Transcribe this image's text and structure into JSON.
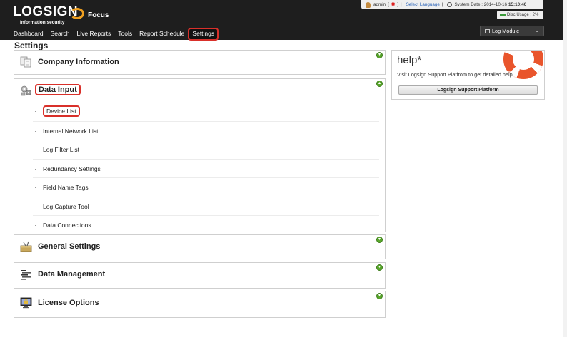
{
  "header": {
    "logo_text": "LOGSIGN",
    "logo_tagline": "information security",
    "product": "Focus",
    "nav": [
      "Dashboard",
      "Search",
      "Live Reports",
      "Tools",
      "Report Schedule",
      "Settings"
    ],
    "active_nav": "Settings",
    "status": {
      "user": "admin",
      "bracket_open": "[",
      "bracket_close": "]",
      "separator": "|",
      "language_link": "Select Language",
      "date_label": "System Date : 2014-10-16",
      "time": "15:10:40"
    },
    "disc_usage": "Disc Usage : 2%",
    "module_select": "Log Module"
  },
  "page_title": "Settings",
  "panels": {
    "company": {
      "title": "Company Information",
      "toggle": "▾"
    },
    "data_input": {
      "title": "Data Input",
      "toggle": "▴",
      "items": [
        "Device List",
        "Internal Network List",
        "Log Filter List",
        "Redundancy Settings",
        "Field Name Tags",
        "Log Capture Tool",
        "Data Connections"
      ]
    },
    "general": {
      "title": "General Settings",
      "toggle": "▾"
    },
    "data_management": {
      "title": "Data Management",
      "toggle": "▾"
    },
    "license": {
      "title": "License Options",
      "toggle": "▾"
    }
  },
  "help": {
    "title": "help*",
    "text": "Visit Logsign Support Platfrom to get detailed help.",
    "button": "Logsign Support Platform"
  },
  "colors": {
    "topbar": "#1e1e1e",
    "highlight": "#d9302a",
    "toggle": "#5aa82c",
    "lifebuoy": "#e9552c"
  }
}
